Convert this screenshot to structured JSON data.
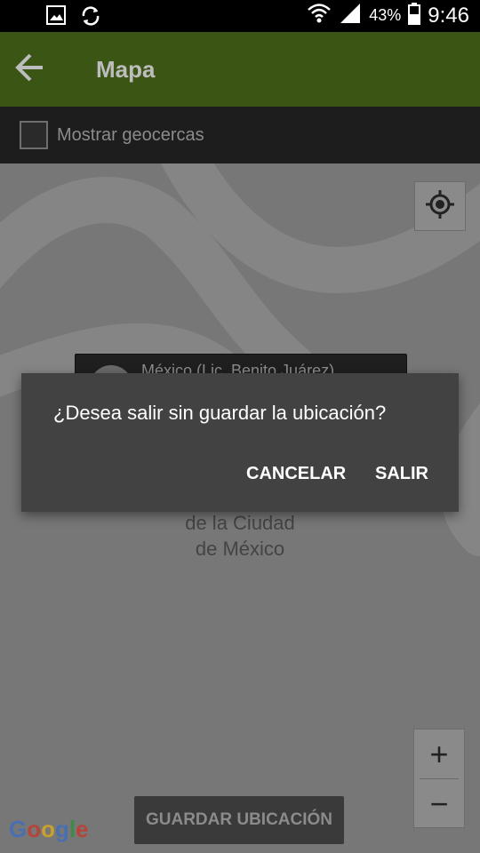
{
  "status_bar": {
    "icons": [
      "image-icon",
      "sync-icon",
      "wifi-icon",
      "signal-icon",
      "battery-icon"
    ],
    "battery_percent": "43%",
    "time": "9:46"
  },
  "app_bar": {
    "title": "Mapa",
    "back_icon": "arrow-back-icon",
    "color": "#3b5514"
  },
  "geofence_bar": {
    "checkbox_checked": false,
    "label": "Mostrar geocercas"
  },
  "map": {
    "info_window_text": "México (Lic. Benito Juárez)",
    "label_lines": [
      "de la Ciudad",
      "de México"
    ],
    "locate_icon": "my-location-icon",
    "zoom_in": "+",
    "zoom_out": "−",
    "attribution": "Google"
  },
  "save_button": {
    "label": "GUARDAR UBICACIÓN"
  },
  "dialog": {
    "message": "¿Desea salir sin guardar la ubicación?",
    "cancel_label": "CANCELAR",
    "exit_label": "SALIR"
  }
}
